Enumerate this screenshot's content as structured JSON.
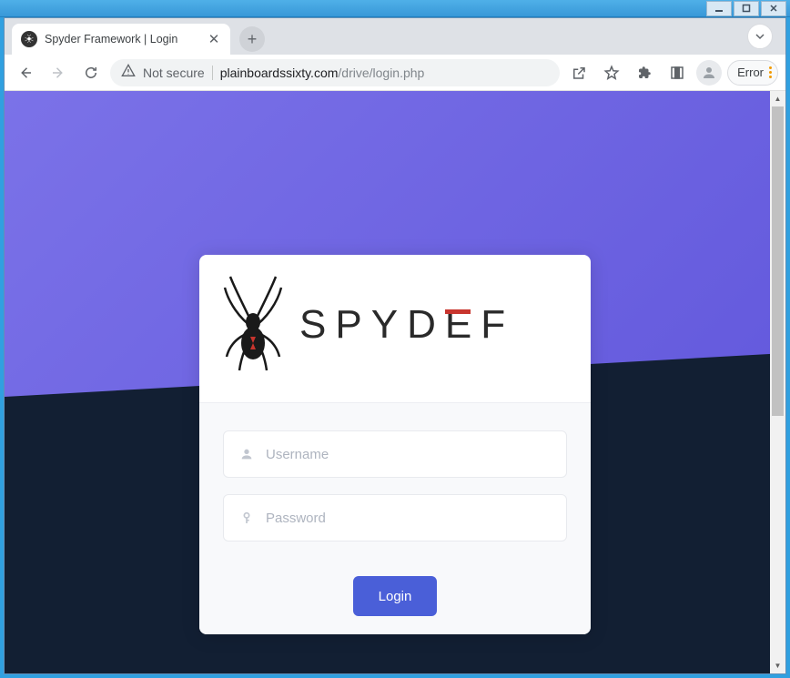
{
  "window": {
    "minimize_glyph": "—",
    "maximize_glyph": "□",
    "close_glyph": "✕"
  },
  "browser": {
    "tab": {
      "title": "Spyder Framework | Login",
      "close_glyph": "✕"
    },
    "newtab_glyph": "+",
    "dropdown_glyph": "⌄",
    "toolbar": {
      "not_secure_label": "Not secure",
      "url_domain": "plainboardssixty.com",
      "url_path": "/drive/login.php",
      "error_label": "Error"
    }
  },
  "page": {
    "logo_text": "SPYDEF",
    "username": {
      "value": "",
      "placeholder": "Username"
    },
    "password": {
      "value": "",
      "placeholder": "Password"
    },
    "login_button_label": "Login"
  }
}
